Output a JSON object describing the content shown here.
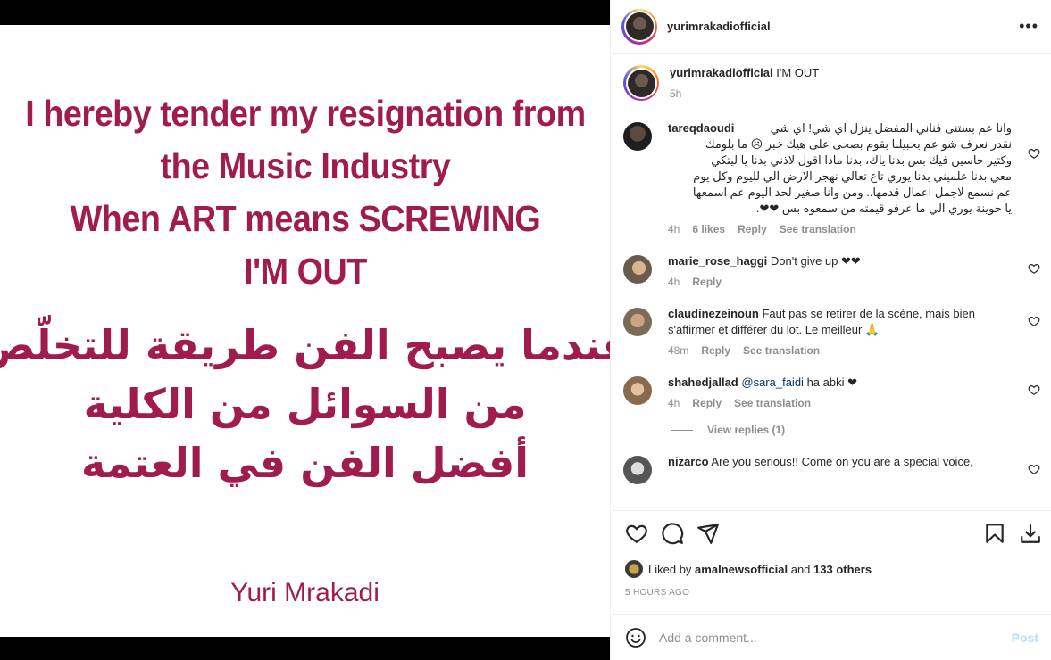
{
  "media": {
    "english_lines": [
      "I hereby tender my resignation from",
      "the Music Industry",
      "When ART means SCREWING",
      "I'M OUT"
    ],
    "arabic_lines": [
      "عندما يصبح الفن طريقة للتخلّص",
      "من السوائل من الكلية",
      "أفضل الفن في العتمة"
    ],
    "signature": "Yuri Mrakadi",
    "text_color": "#a01c4e"
  },
  "header": {
    "username": "yurimrakadiofficial",
    "more_icon": "more-horizontal-icon"
  },
  "caption": {
    "username": "yurimrakadiofficial",
    "text": "I'M OUT",
    "time": "5h"
  },
  "comments": [
    {
      "username": "tareqdaoudi",
      "lines": [
        "وانا عم بستنى فناني المفضل ينزل اي شي! اي شي",
        "نقدر نعرف شو عم بخبيلنا بقوم بصحى على هيك خبر ☹ ما بلومك",
        "وكتير حاسين فيك بس بدنا ياك، بدنا ماذا اقول لاذني بدنا يا ليتكي",
        "معي بدنا علميني بدنا يوري تاع تعالي نهجر الارض الي لليوم وكل يوم",
        "عم نسمع لاجمل اعمال قدمها.. ومن وانا صغير لحد اليوم عم اسمعها",
        "يا حوينة يوري الي ما عرفو قيمته من سمعوه بس ❤❤."
      ],
      "time": "4h",
      "likes": "6 likes",
      "reply": "Reply",
      "translate": "See translation"
    },
    {
      "username": "marie_rose_haggi",
      "text": "Don't give up ❤❤",
      "time": "4h",
      "reply": "Reply"
    },
    {
      "username": "claudinezeinoun",
      "text": "Faut pas se retirer de la scène, mais bien s'affirmer et différer du lot. Le meilleur 🙏",
      "time": "48m",
      "reply": "Reply",
      "translate": "See translation"
    },
    {
      "username": "shahedjallad",
      "mention": "@sara_faidi",
      "text": "ha abki ❤",
      "time": "4h",
      "reply": "Reply",
      "translate": "See translation",
      "view_replies": "View replies (1)"
    },
    {
      "username": "nizarco",
      "text": "Are you serious!! Come on you are a special voice,"
    }
  ],
  "likes": {
    "prefix": "Liked by",
    "user": "amalnewsofficial",
    "suffix": "and",
    "others": "133 others"
  },
  "timestamp": "5 HOURS AGO",
  "add_comment": {
    "placeholder": "Add a comment...",
    "post_label": "Post"
  },
  "colors": {
    "link_blue": "#00376b",
    "post_disabled": "#b2dffc",
    "heart_red": "#e0245e"
  }
}
